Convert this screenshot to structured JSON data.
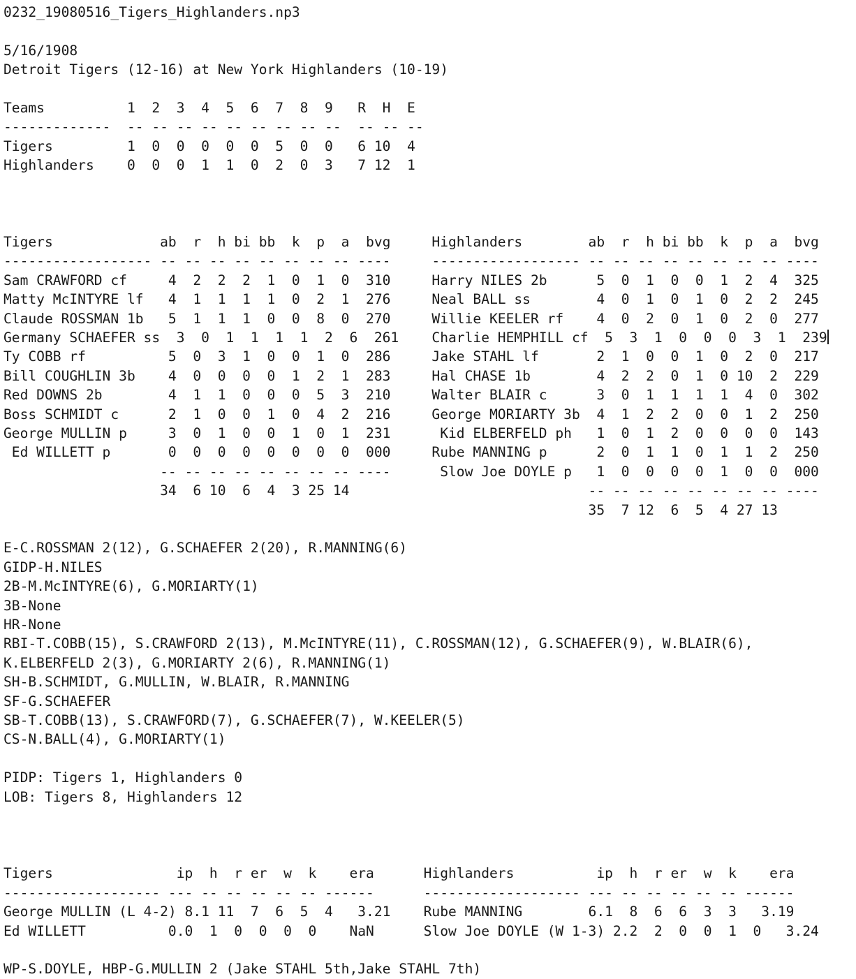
{
  "file": {
    "name": "0232_19080516_Tigers_Highlanders.np3"
  },
  "game": {
    "date": "5/16/1908",
    "matchup": "Detroit Tigers (12-16) at New York Highlanders (10-19)",
    "away_team": "Detroit Tigers",
    "away_record": "(12-16)",
    "home_team": "New York Highlanders",
    "home_record": "(10-19)"
  },
  "linescore": {
    "header_label": "Teams",
    "inning_labels": [
      "1",
      "2",
      "3",
      "4",
      "5",
      "6",
      "7",
      "8",
      "9"
    ],
    "summary_labels": [
      "R",
      "H",
      "E"
    ],
    "rule": "-------------  -- -- -- -- -- -- -- -- --  -- -- --",
    "rows": [
      {
        "team": "Tigers",
        "innings": [
          "1",
          "0",
          "0",
          "0",
          "0",
          "0",
          "5",
          "0",
          "0"
        ],
        "r": "6",
        "h": "10",
        "e": "4"
      },
      {
        "team": "Highlanders",
        "innings": [
          "0",
          "0",
          "0",
          "1",
          "1",
          "0",
          "2",
          "0",
          "3"
        ],
        "r": "7",
        "h": "12",
        "e": "1"
      }
    ]
  },
  "batting": {
    "columns": [
      "ab",
      "r",
      "h",
      "bi",
      "bb",
      "k",
      "p",
      "a",
      "bvg"
    ],
    "rule": "------------------ -- -- -- -- -- -- -- -- ----",
    "totals_rule": "-- -- -- -- -- -- -- -- ----",
    "away": {
      "team": "Tigers",
      "players": [
        {
          "name": "Sam CRAWFORD cf",
          "sub": false,
          "ab": "4",
          "r": "2",
          "h": "2",
          "bi": "2",
          "bb": "1",
          "k": "0",
          "p": "1",
          "a": "0",
          "bvg": "310"
        },
        {
          "name": "Matty McINTYRE lf",
          "sub": false,
          "ab": "4",
          "r": "1",
          "h": "1",
          "bi": "1",
          "bb": "1",
          "k": "0",
          "p": "2",
          "a": "1",
          "bvg": "276"
        },
        {
          "name": "Claude ROSSMAN 1b",
          "sub": false,
          "ab": "5",
          "r": "1",
          "h": "1",
          "bi": "1",
          "bb": "0",
          "k": "0",
          "p": "8",
          "a": "0",
          "bvg": "270"
        },
        {
          "name": "Germany SCHAEFER ss",
          "sub": false,
          "ab": "3",
          "r": "0",
          "h": "1",
          "bi": "1",
          "bb": "1",
          "k": "1",
          "p": "2",
          "a": "6",
          "bvg": "261"
        },
        {
          "name": "Ty COBB rf",
          "sub": false,
          "ab": "5",
          "r": "0",
          "h": "3",
          "bi": "1",
          "bb": "0",
          "k": "0",
          "p": "1",
          "a": "0",
          "bvg": "286"
        },
        {
          "name": "Bill COUGHLIN 3b",
          "sub": false,
          "ab": "4",
          "r": "0",
          "h": "0",
          "bi": "0",
          "bb": "0",
          "k": "1",
          "p": "2",
          "a": "1",
          "bvg": "283"
        },
        {
          "name": "Red DOWNS 2b",
          "sub": false,
          "ab": "4",
          "r": "1",
          "h": "1",
          "bi": "0",
          "bb": "0",
          "k": "0",
          "p": "5",
          "a": "3",
          "bvg": "210"
        },
        {
          "name": "Boss SCHMIDT c",
          "sub": false,
          "ab": "2",
          "r": "1",
          "h": "0",
          "bi": "0",
          "bb": "1",
          "k": "0",
          "p": "4",
          "a": "2",
          "bvg": "216"
        },
        {
          "name": "George MULLIN p",
          "sub": false,
          "ab": "3",
          "r": "0",
          "h": "1",
          "bi": "0",
          "bb": "0",
          "k": "1",
          "p": "0",
          "a": "1",
          "bvg": "231"
        },
        {
          "name": "Ed WILLETT p",
          "sub": true,
          "ab": "0",
          "r": "0",
          "h": "0",
          "bi": "0",
          "bb": "0",
          "k": "0",
          "p": "0",
          "a": "0",
          "bvg": "000"
        }
      ],
      "totals": {
        "ab": "34",
        "r": "6",
        "h": "10",
        "bi": "6",
        "bb": "4",
        "k": "3",
        "p": "25",
        "a": "14"
      }
    },
    "home": {
      "team": "Highlanders",
      "players": [
        {
          "name": "Harry NILES 2b",
          "sub": false,
          "ab": "5",
          "r": "0",
          "h": "1",
          "bi": "0",
          "bb": "0",
          "k": "1",
          "p": "2",
          "a": "4",
          "bvg": "325"
        },
        {
          "name": "Neal BALL ss",
          "sub": false,
          "ab": "4",
          "r": "0",
          "h": "1",
          "bi": "0",
          "bb": "1",
          "k": "0",
          "p": "2",
          "a": "2",
          "bvg": "245"
        },
        {
          "name": "Willie KEELER rf",
          "sub": false,
          "ab": "4",
          "r": "0",
          "h": "2",
          "bi": "0",
          "bb": "1",
          "k": "0",
          "p": "2",
          "a": "0",
          "bvg": "277"
        },
        {
          "name": "Charlie HEMPHILL cf",
          "sub": false,
          "ab": "5",
          "r": "3",
          "h": "1",
          "bi": "0",
          "bb": "0",
          "k": "0",
          "p": "3",
          "a": "1",
          "bvg": "239"
        },
        {
          "name": "Jake STAHL lf",
          "sub": false,
          "ab": "2",
          "r": "1",
          "h": "0",
          "bi": "0",
          "bb": "1",
          "k": "0",
          "p": "2",
          "a": "0",
          "bvg": "217"
        },
        {
          "name": "Hal CHASE 1b",
          "sub": false,
          "ab": "4",
          "r": "2",
          "h": "2",
          "bi": "0",
          "bb": "1",
          "k": "0",
          "p": "10",
          "a": "2",
          "bvg": "229"
        },
        {
          "name": "Walter BLAIR c",
          "sub": false,
          "ab": "3",
          "r": "0",
          "h": "1",
          "bi": "1",
          "bb": "1",
          "k": "1",
          "p": "4",
          "a": "0",
          "bvg": "302"
        },
        {
          "name": "George MORIARTY 3b",
          "sub": false,
          "ab": "4",
          "r": "1",
          "h": "2",
          "bi": "2",
          "bb": "0",
          "k": "0",
          "p": "1",
          "a": "2",
          "bvg": "250"
        },
        {
          "name": "Kid ELBERFELD ph",
          "sub": true,
          "ab": "1",
          "r": "0",
          "h": "1",
          "bi": "2",
          "bb": "0",
          "k": "0",
          "p": "0",
          "a": "0",
          "bvg": "143"
        },
        {
          "name": "Rube MANNING p",
          "sub": false,
          "ab": "2",
          "r": "0",
          "h": "1",
          "bi": "1",
          "bb": "0",
          "k": "1",
          "p": "1",
          "a": "2",
          "bvg": "250"
        },
        {
          "name": "Slow Joe DOYLE p",
          "sub": true,
          "ab": "1",
          "r": "0",
          "h": "0",
          "bi": "0",
          "bb": "0",
          "k": "1",
          "p": "0",
          "a": "0",
          "bvg": "000"
        }
      ],
      "totals": {
        "ab": "35",
        "r": "7",
        "h": "12",
        "bi": "6",
        "bb": "5",
        "k": "4",
        "p": "27",
        "a": "13"
      }
    }
  },
  "notes": [
    "E-C.ROSSMAN 2(12), G.SCHAEFER 2(20), R.MANNING(6)",
    "GIDP-H.NILES",
    "2B-M.McINTYRE(6), G.MORIARTY(1)",
    "3B-None",
    "HR-None",
    "RBI-T.COBB(15), S.CRAWFORD 2(13), M.McINTYRE(11), C.ROSSMAN(12), G.SCHAEFER(9), W.BLAIR(6),",
    "K.ELBERFELD 2(3), G.MORIARTY 2(6), R.MANNING(1)",
    "SH-B.SCHMIDT, G.MULLIN, W.BLAIR, R.MANNING",
    "SF-G.SCHAEFER",
    "SB-T.COBB(13), S.CRAWFORD(7), G.SCHAEFER(7), W.KEELER(5)",
    "CS-N.BALL(4), G.MORIARTY(1)"
  ],
  "situational": {
    "pidp": "PIDP: Tigers 1, Highlanders 0",
    "lob": "LOB: Tigers 8, Highlanders 12"
  },
  "pitching": {
    "columns": [
      "ip",
      "h",
      "r",
      "er",
      "w",
      "k",
      "era"
    ],
    "rule": "------------------- --- -- -- -- -- -- ------",
    "away": {
      "team": "Tigers",
      "pitchers": [
        {
          "name": "George MULLIN (L 4-2)",
          "ip": "8.1",
          "h": "11",
          "r": "7",
          "er": "6",
          "w": "5",
          "k": "4",
          "era": "3.21"
        },
        {
          "name": "Ed WILLETT",
          "ip": "0.0",
          "h": "1",
          "r": "0",
          "er": "0",
          "w": "0",
          "k": "0",
          "era": "NaN"
        }
      ]
    },
    "home": {
      "team": "Highlanders",
      "pitchers": [
        {
          "name": "Rube MANNING",
          "ip": "6.1",
          "h": "8",
          "r": "6",
          "er": "6",
          "w": "3",
          "k": "3",
          "era": "3.19"
        },
        {
          "name": "Slow Joe DOYLE (W 1-3)",
          "ip": "2.2",
          "h": "2",
          "r": "0",
          "er": "0",
          "w": "1",
          "k": "0",
          "era": "3.24"
        }
      ]
    }
  },
  "footer": {
    "line": "WP-S.DOYLE, HBP-G.MULLIN 2 (Jake STAHL 5th,Jake STAHL 7th)"
  }
}
